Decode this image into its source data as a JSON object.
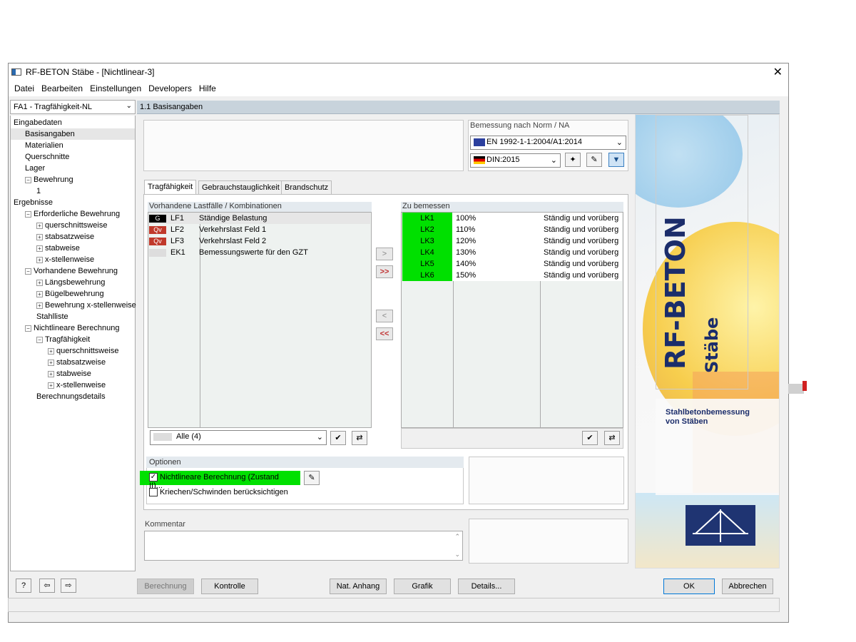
{
  "window": {
    "title": "RF-BETON Stäbe - [Nichtlinear-3]",
    "close_glyph": "✕"
  },
  "menu": [
    "Datei",
    "Bearbeiten",
    "Einstellungen",
    "Developers",
    "Hilfe"
  ],
  "case_dropdown": "FA1 - Tragfähigkeit-NL",
  "tree": [
    {
      "label": "Eingabedaten",
      "indent": 0
    },
    {
      "label": "Basisangaben",
      "indent": 1,
      "selected": true
    },
    {
      "label": "Materialien",
      "indent": 1
    },
    {
      "label": "Querschnitte",
      "indent": 1
    },
    {
      "label": "Lager",
      "indent": 1
    },
    {
      "label": "Bewehrung",
      "indent": 1,
      "expander": "−"
    },
    {
      "label": "1",
      "indent": 2
    },
    {
      "label": "Ergebnisse",
      "indent": 0
    },
    {
      "label": "Erforderliche Bewehrung",
      "indent": 1,
      "expander": "−"
    },
    {
      "label": "querschnittsweise",
      "indent": 2,
      "expander": "+"
    },
    {
      "label": "stabsatzweise",
      "indent": 2,
      "expander": "+"
    },
    {
      "label": "stabweise",
      "indent": 2,
      "expander": "+"
    },
    {
      "label": "x-stellenweise",
      "indent": 2,
      "expander": "+"
    },
    {
      "label": "Vorhandene Bewehrung",
      "indent": 1,
      "expander": "−"
    },
    {
      "label": "Längsbewehrung",
      "indent": 2,
      "expander": "+"
    },
    {
      "label": "Bügelbewehrung",
      "indent": 2,
      "expander": "+"
    },
    {
      "label": "Bewehrung x-stellenweise",
      "indent": 2,
      "expander": "+"
    },
    {
      "label": "Stahlliste",
      "indent": 2
    },
    {
      "label": "Nichtlineare Berechnung",
      "indent": 1,
      "expander": "−"
    },
    {
      "label": "Tragfähigkeit",
      "indent": 2,
      "expander": "−"
    },
    {
      "label": "querschnittsweise",
      "indent": 3,
      "expander": "+"
    },
    {
      "label": "stabsatzweise",
      "indent": 3,
      "expander": "+"
    },
    {
      "label": "stabweise",
      "indent": 3,
      "expander": "+"
    },
    {
      "label": "x-stellenweise",
      "indent": 3,
      "expander": "+"
    },
    {
      "label": "Berechnungsdetails",
      "indent": 2
    }
  ],
  "section_header": "1.1 Basisangaben",
  "norm": {
    "label": "Bemessung nach Norm / NA",
    "norm_value": "EN 1992-1-1:2004/A1:2014",
    "na_value": "DIN:2015"
  },
  "tabs": [
    "Tragfähigkeit",
    "Gebrauchstauglichkeit",
    "Brandschutz"
  ],
  "available": {
    "label": "Vorhandene Lastfälle / Kombinationen",
    "rows": [
      {
        "badge": "G",
        "badge_color": "#000000",
        "id": "LF1",
        "desc": "Ständige Belastung"
      },
      {
        "badge": "Qv",
        "badge_color": "#c0392b",
        "id": "LF2",
        "desc": "Verkehrslast Feld 1"
      },
      {
        "badge": "Qv",
        "badge_color": "#c0392b",
        "id": "LF3",
        "desc": "Verkehrslast Feld 2"
      },
      {
        "badge": "",
        "badge_color": "#dddddd",
        "id": "EK1",
        "desc": "Bemessungswerte für den GZT"
      }
    ],
    "filter": "Alle (4)"
  },
  "to_design": {
    "label": "Zu bemessen",
    "rows": [
      {
        "id": "LK1",
        "factor": "100%",
        "desc": "Ständig und vorüberg"
      },
      {
        "id": "LK2",
        "factor": "110%",
        "desc": "Ständig und vorüberg"
      },
      {
        "id": "LK3",
        "factor": "120%",
        "desc": "Ständig und vorüberg"
      },
      {
        "id": "LK4",
        "factor": "130%",
        "desc": "Ständig und vorüberg"
      },
      {
        "id": "LK5",
        "factor": "140%",
        "desc": "Ständig und vorüberg"
      },
      {
        "id": "LK6",
        "factor": "150%",
        "desc": "Ständig und vorüberg"
      }
    ],
    "highlight_color": "#00e000"
  },
  "arrows": {
    "add": ">",
    "add_all": ">>",
    "remove": "<",
    "remove_all": "<<"
  },
  "options": {
    "label": "Optionen",
    "nonlinear": "Nichtlineare Berechnung (Zustand II)...",
    "creep": "Kriechen/Schwinden berücksichtigen"
  },
  "comment": {
    "label": "Kommentar"
  },
  "graphic": {
    "product": "RF-BETON",
    "subtitle": "Stäbe",
    "tagline_1": "Stahlbetonbemessung",
    "tagline_2": "von Stäben"
  },
  "buttons": {
    "calc": "Berechnung",
    "check": "Kontrolle",
    "annex": "Nat. Anhang",
    "graphic": "Grafik",
    "details": "Details...",
    "ok": "OK",
    "cancel": "Abbrechen"
  }
}
